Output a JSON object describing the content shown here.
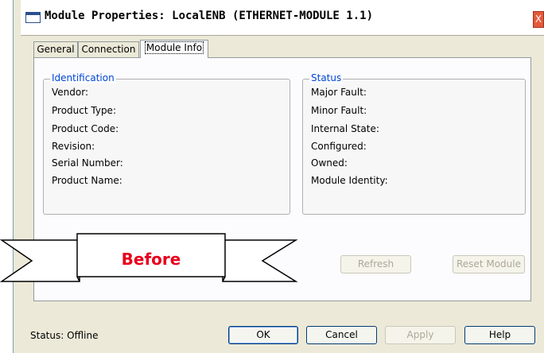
{
  "window": {
    "title": "Module Properties: LocalENB (ETHERNET-MODULE 1.1)",
    "close_glyph": "X"
  },
  "tabs": [
    {
      "label": "General"
    },
    {
      "label": "Connection"
    },
    {
      "label": "Module Info"
    }
  ],
  "identification": {
    "legend": "Identification",
    "labels": [
      "Vendor:",
      "Product Type:",
      "Product Code:",
      "Revision:",
      "Serial Number:",
      "Product Name:"
    ]
  },
  "status_group": {
    "legend": "Status",
    "labels": [
      "Major Fault:",
      "Minor Fault:",
      "Internal State:",
      "Configured:",
      "Owned:",
      "Module Identity:"
    ]
  },
  "buttons": {
    "refresh": "Refresh",
    "reset_module": "Reset Module",
    "ok": "OK",
    "cancel": "Cancel",
    "apply": "Apply",
    "help": "Help"
  },
  "status_bar": {
    "text": "Status:  Offline"
  },
  "callout": {
    "label": "Before",
    "color": "#e8001c"
  },
  "colors": {
    "legend_blue": "#0046d5",
    "close_red": "#e35a3a"
  }
}
